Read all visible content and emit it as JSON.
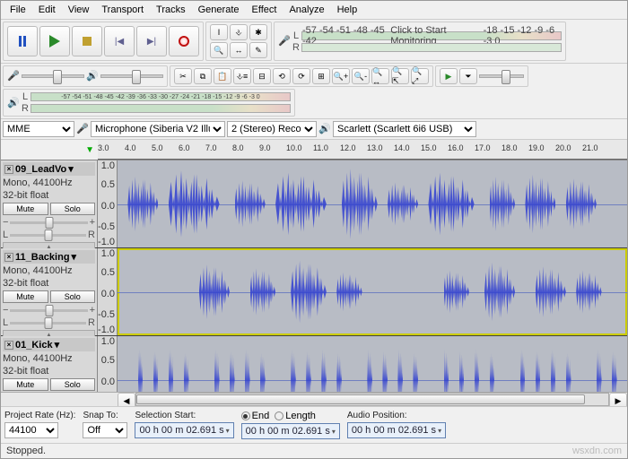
{
  "menu": [
    "File",
    "Edit",
    "View",
    "Transport",
    "Tracks",
    "Generate",
    "Effect",
    "Analyze",
    "Help"
  ],
  "transport": {
    "pause": "pause",
    "play": "play",
    "stop": "stop",
    "skip_start": "skip-start",
    "skip_end": "skip-end",
    "record": "record"
  },
  "tool_grid": [
    "I",
    "⎀",
    "✱",
    "🔍",
    "↔",
    "✎"
  ],
  "meters": {
    "rec_scale": "-57 -54 -51 -48 -45 -42",
    "rec_click": "Click to Start Monitoring",
    "rec_scale2": "-18 -15 -12 -9 -6 -3 0",
    "play_scale": "-57 -54 -51 -48 -45 -42 -39 -36 -33 -30 -27 -24 -21 -18 -15 -12 -9 -6 -3 0"
  },
  "edit_tools": [
    "✂",
    "⧉",
    "📋",
    "⎀≡",
    "⟲",
    "⟳",
    "🔍+",
    "🔍-",
    "🔍↔",
    "🔍⇱",
    "🔍⤢",
    "▶",
    "⏷"
  ],
  "device": {
    "host_api": "MME",
    "rec_device": "Microphone (Siberia V2 Illu",
    "rec_channels": "2 (Stereo) Recor",
    "play_device": "Scarlett (Scarlett 6i6 USB)"
  },
  "ruler_ticks": [
    "3.0",
    "4.0",
    "5.0",
    "6.0",
    "7.0",
    "8.0",
    "9.0",
    "10.0",
    "11.0",
    "12.0",
    "13.0",
    "14.0",
    "15.0",
    "16.0",
    "17.0",
    "18.0",
    "19.0",
    "20.0",
    "21.0"
  ],
  "tracks": [
    {
      "name": "09_LeadVo",
      "format": "Mono, 44100Hz",
      "bit": "32-bit float",
      "mute": "Mute",
      "solo": "Solo",
      "selected": false,
      "bursts": [
        [
          0.02,
          0.06,
          0.7
        ],
        [
          0.1,
          0.1,
          0.85
        ],
        [
          0.23,
          0.06,
          0.6
        ],
        [
          0.31,
          0.1,
          0.8
        ],
        [
          0.44,
          0.07,
          0.9
        ],
        [
          0.53,
          0.06,
          0.55
        ],
        [
          0.61,
          0.09,
          0.8
        ],
        [
          0.73,
          0.05,
          0.7
        ],
        [
          0.8,
          0.06,
          0.75
        ],
        [
          0.88,
          0.06,
          0.65
        ]
      ]
    },
    {
      "name": "11_Backing",
      "format": "Mono, 44100Hz",
      "bit": "32-bit float",
      "mute": "Mute",
      "solo": "Solo",
      "selected": true,
      "bursts": [
        [
          0.16,
          0.06,
          0.7
        ],
        [
          0.26,
          0.05,
          0.6
        ],
        [
          0.34,
          0.07,
          0.8
        ],
        [
          0.43,
          0.05,
          0.5
        ],
        [
          0.64,
          0.05,
          0.55
        ],
        [
          0.72,
          0.06,
          0.75
        ],
        [
          0.82,
          0.06,
          0.65
        ],
        [
          0.9,
          0.05,
          0.55
        ]
      ]
    },
    {
      "name": "01_Kick",
      "format": "Mono, 44100Hz",
      "bit": "32-bit float",
      "mute": "Mute",
      "solo": "Solo",
      "selected": false,
      "bursts": [
        [
          0.04,
          0.01,
          0.8
        ],
        [
          0.07,
          0.01,
          0.75
        ],
        [
          0.1,
          0.01,
          0.8
        ],
        [
          0.13,
          0.01,
          0.7
        ],
        [
          0.19,
          0.01,
          0.8
        ],
        [
          0.22,
          0.01,
          0.75
        ],
        [
          0.25,
          0.01,
          0.8
        ],
        [
          0.28,
          0.01,
          0.7
        ],
        [
          0.34,
          0.01,
          0.8
        ],
        [
          0.37,
          0.01,
          0.75
        ],
        [
          0.4,
          0.01,
          0.8
        ],
        [
          0.43,
          0.01,
          0.7
        ],
        [
          0.49,
          0.01,
          0.8
        ],
        [
          0.52,
          0.01,
          0.75
        ],
        [
          0.55,
          0.01,
          0.8
        ],
        [
          0.58,
          0.01,
          0.7
        ],
        [
          0.64,
          0.01,
          0.8
        ],
        [
          0.67,
          0.01,
          0.75
        ],
        [
          0.7,
          0.01,
          0.8
        ],
        [
          0.73,
          0.01,
          0.7
        ],
        [
          0.79,
          0.01,
          0.8
        ],
        [
          0.82,
          0.01,
          0.75
        ],
        [
          0.85,
          0.01,
          0.8
        ],
        [
          0.88,
          0.01,
          0.7
        ],
        [
          0.94,
          0.01,
          0.8
        ],
        [
          0.97,
          0.01,
          0.75
        ]
      ]
    }
  ],
  "scale": [
    "1.0",
    "0.5",
    "0.0",
    "-0.5",
    "-1.0"
  ],
  "selbar": {
    "project_rate_label": "Project Rate (Hz):",
    "project_rate": "44100",
    "snap_label": "Snap To:",
    "snap": "Off",
    "sel_start_label": "Selection Start:",
    "sel_start": "00 h 00 m 02.691 s",
    "end_label": "End",
    "length_label": "Length",
    "sel_end": "00 h 00 m 02.691 s",
    "audio_pos_label": "Audio Position:",
    "audio_pos": "00 h 00 m 02.691 s"
  },
  "status": "Stopped.",
  "slider_labels": {
    "minus": "−",
    "plus": "+",
    "L": "L",
    "R": "R"
  },
  "watermark": "wsxdn.com"
}
